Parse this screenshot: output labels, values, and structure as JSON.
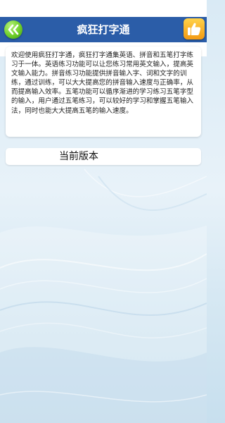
{
  "header": {
    "title": "疯狂打字通",
    "back_icon": "double-chevron-left-icon",
    "like_icon": "thumbs-up-icon"
  },
  "intro": {
    "text": "欢迎使用疯狂打字通，疯狂打字通集英语、拼音和五笔打字练习于一体。英语练习功能可以让您练习常用英文输入，提高英文输入能力。拼音练习功能提供拼音输入字、词和文字的训练，通过训练，可以大大提高您的拼音输入速度与正确率，从而提高输入效率。五笔功能可以循序渐进的学习练习五笔字型的输入，用户通过五笔练习，可以较好的学习和掌握五笔输入法，同时也能大大提高五笔的输入速度。"
  },
  "version": {
    "label": "当前版本"
  },
  "colors": {
    "title_bar": "#2b5da8",
    "back_button": "#6fcf2a",
    "like_button": "#f39a12",
    "card_background": "#ffffff"
  }
}
